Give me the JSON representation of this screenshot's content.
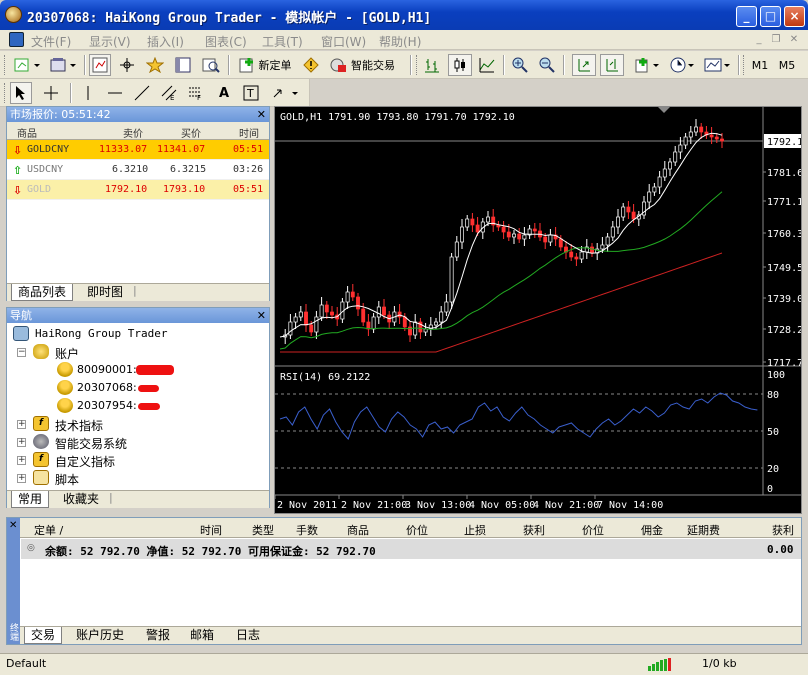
{
  "window": {
    "title": "20307068: HaiKong Group Trader - 模拟帐户 - [GOLD,H1]",
    "min": "_",
    "max": "□",
    "close": "×"
  },
  "menu": [
    "文件(F)",
    "显示(V)",
    "插入(I)",
    "图表(C)",
    "工具(T)",
    "窗口(W)",
    "帮助(H)"
  ],
  "toolbar": {
    "new_order": "新定单",
    "expert": "智能交易",
    "m1": "M1",
    "m5": "M5"
  },
  "market_watch": {
    "title": "市场报价: 05:51:42",
    "columns": [
      "商品",
      "卖价",
      "买价",
      "时间"
    ],
    "rows": [
      {
        "symbol": "GOLDCNY",
        "bid": "11333.07",
        "ask": "11341.07",
        "time": "05:51",
        "dir": "down"
      },
      {
        "symbol": "USDCNY",
        "bid": "6.3210",
        "ask": "6.3215",
        "time": "03:26",
        "dir": "up"
      },
      {
        "symbol": "GOLD",
        "bid": "1792.10",
        "ask": "1793.10",
        "time": "05:51",
        "dir": "down"
      }
    ],
    "tabs": [
      "商品列表",
      "即时图"
    ]
  },
  "navigator": {
    "title": "导航",
    "root": "HaiRong Group Trader",
    "accounts_label": "账户",
    "accounts": [
      "80090001:",
      "20307068:",
      "20307954:"
    ],
    "folders": [
      "技术指标",
      "智能交易系统",
      "自定义指标",
      "脚本"
    ],
    "tabs": [
      "常用",
      "收藏夹"
    ]
  },
  "chart": {
    "header": "GOLD,H1  1791.90 1793.80 1791.70 1792.10",
    "current_price": "1792.10",
    "price_ticks": [
      "1781.60",
      "1771.10",
      "1760.30",
      "1749.50",
      "1739.00",
      "1728.20",
      "1717.70"
    ],
    "rsi_label": "RSI(14) 69.2122",
    "rsi_ticks": [
      "100",
      "80",
      "50",
      "20",
      "0"
    ],
    "time_ticks": [
      "2 Nov 2011",
      "2 Nov 21:00",
      "3 Nov 13:00",
      "4 Nov 05:00",
      "4 Nov 21:00",
      "7 Nov 14:00"
    ],
    "colors": {
      "up": "#ff3030",
      "down": "#ffffff",
      "ma_fast": "#ffffff",
      "ma_mid": "#22aa22",
      "ma_slow": "#cc2222",
      "rsi": "#3a5fcd"
    }
  },
  "terminal": {
    "side_label": "终端",
    "columns": [
      "定单 /",
      "时间",
      "类型",
      "手数",
      "商品",
      "价位",
      "止损",
      "获利",
      "价位",
      "佣金",
      "延期费",
      "获利"
    ],
    "balance_row": {
      "text": "余额: 52 792.70  净值: 52 792.70  可用保证金: 52 792.70",
      "profit": "0.00"
    },
    "tabs": [
      "交易",
      "账户历史",
      "警报",
      "邮箱",
      "日志"
    ]
  },
  "status": {
    "profile": "Default",
    "traffic": "1/0 kb"
  }
}
